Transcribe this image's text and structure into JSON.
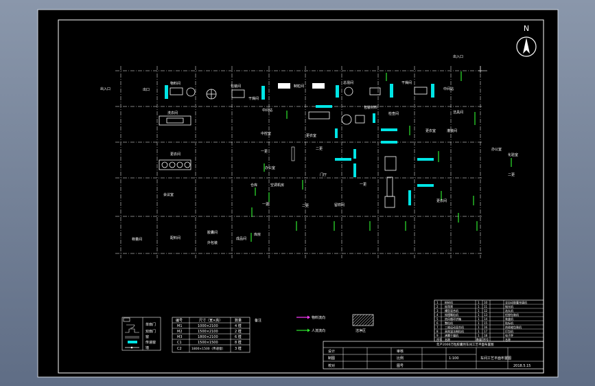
{
  "compass": {
    "label": "N"
  },
  "drawing": {
    "room_labels": [
      "出入口",
      "出入口",
      "出口",
      "物料间",
      "包装间",
      "干燥间",
      "制粒间",
      "总混间",
      "干燥间",
      "中间站",
      "洗衣间",
      "中间站",
      "包装材料",
      "检查间",
      "洁具间",
      "灌装间",
      "中控室",
      "更衣室",
      "更衣室",
      "更衣间",
      "一更",
      "二更",
      "办公室",
      "化验室",
      "门厅",
      "办公室",
      "一更",
      "二更",
      "会议室",
      "仓库",
      "空调机房",
      "更衣间",
      "一更",
      "二更",
      "留样间",
      "称量间",
      "配料间",
      "胶囊间",
      "外包装",
      "成品间",
      "库房"
    ]
  },
  "legend_symbols": {
    "items": [
      {
        "symbol": "door",
        "label": "单扇门"
      },
      {
        "symbol": "double-door",
        "label": "双扇门"
      },
      {
        "symbol": "window",
        "label": "窗"
      },
      {
        "symbol": "air-lock",
        "label": "传递窗"
      },
      {
        "symbol": "wall",
        "label": "墙"
      }
    ]
  },
  "legend_table": {
    "side_label": "备注",
    "headers": [
      "编号",
      "尺寸（宽×高）",
      "数量"
    ],
    "rows": [
      [
        "M1",
        "1000×2100",
        "4 樘"
      ],
      [
        "M2",
        "1500×2100",
        "2 樘"
      ],
      [
        "M3",
        "1800×2100",
        "6 樘"
      ],
      [
        "C1",
        "1500×1500",
        "8 樘"
      ],
      [
        "C2",
        "1800×1500（传递窗）",
        "3 樘"
      ]
    ]
  },
  "flow_legend": {
    "items": [
      {
        "label": "物料流向",
        "color": "#ff3dff"
      },
      {
        "label": "人流流向",
        "color": "#2ee82e"
      }
    ],
    "hatch_label": "洁净区"
  },
  "equipment_list": {
    "rows": [
      [
        "1",
        "粉碎机",
        "1",
        "10",
        "全自动胶囊充填机"
      ],
      [
        "2",
        "振荡筛",
        "1",
        "11",
        "抛光机"
      ],
      [
        "3",
        "槽型混合机",
        "1",
        "12",
        "选丸机"
      ],
      [
        "4",
        "摇摆颗粒机",
        "1",
        "13",
        "铝塑包装机"
      ],
      [
        "5",
        "热风循环烘箱",
        "1",
        "14",
        "装盒机"
      ],
      [
        "6",
        "整粒机",
        "1",
        "15",
        "贴标机"
      ],
      [
        "7",
        "三维运动混合机",
        "1",
        "16",
        "热收缩包装机"
      ],
      [
        "8",
        "高效湿法制粒机",
        "1",
        "17",
        "打包机"
      ],
      [
        "9",
        "沸腾干燥机",
        "1",
        "18",
        "电子秤"
      ]
    ],
    "header": [
      "序号",
      "名称",
      "数量",
      "序号",
      "名称"
    ]
  },
  "title_block": {
    "project": "年产2000万粒胶囊剂车间工艺平面布置图",
    "rows": [
      [
        "设计",
        "",
        "",
        "审核"
      ],
      [
        "制图",
        "",
        "",
        "比例",
        "1:100"
      ],
      [
        "校对",
        "",
        "",
        "图号"
      ]
    ],
    "title": "车间工艺平面布置图",
    "date": "2018.5.15"
  }
}
